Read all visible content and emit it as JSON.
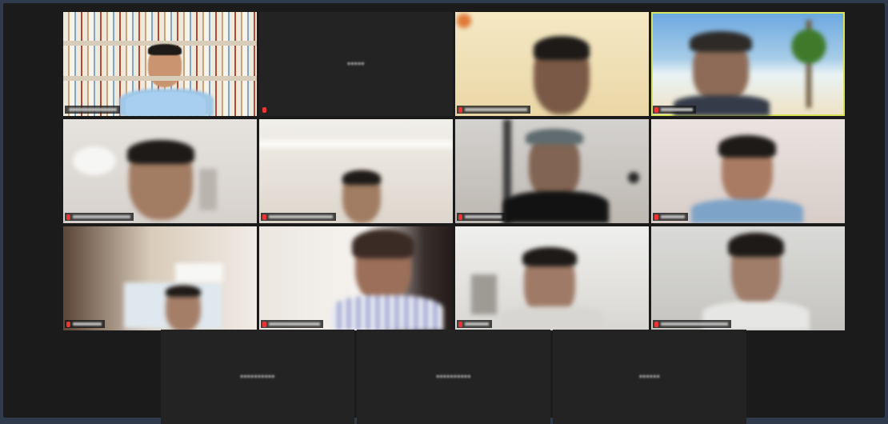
{
  "meeting": {
    "title": "",
    "active_speaker_color": "#d6e45a"
  },
  "participants": [
    {
      "name": "",
      "video": true,
      "backdrop": "bookshelf"
    },
    {
      "name": "",
      "video": false,
      "label": "•••••"
    },
    {
      "name": "",
      "video": true,
      "backdrop": "warm"
    },
    {
      "name": "",
      "video": true,
      "backdrop": "beach",
      "active": true
    },
    {
      "name": "",
      "video": true,
      "backdrop": "roomlight"
    },
    {
      "name": "",
      "video": true,
      "backdrop": "roomwhite"
    },
    {
      "name": "",
      "video": true,
      "backdrop": "gray"
    },
    {
      "name": "",
      "video": true,
      "backdrop": "pinkish"
    },
    {
      "name": "",
      "video": true,
      "backdrop": "brown"
    },
    {
      "name": "",
      "video": true,
      "backdrop": "curtain"
    },
    {
      "name": "",
      "video": true,
      "backdrop": "office"
    },
    {
      "name": "",
      "video": true,
      "backdrop": "office2"
    }
  ],
  "no_video_participants": [
    {
      "label": "••••••••••"
    },
    {
      "label": "••••••••••"
    },
    {
      "label": "••••••"
    }
  ],
  "icons": {
    "mic_muted": "mic-muted-icon"
  },
  "colors": {
    "page_bg": "#2f3a4d",
    "frame_bg": "#1b1b1b",
    "mic_muted": "#e33333"
  }
}
